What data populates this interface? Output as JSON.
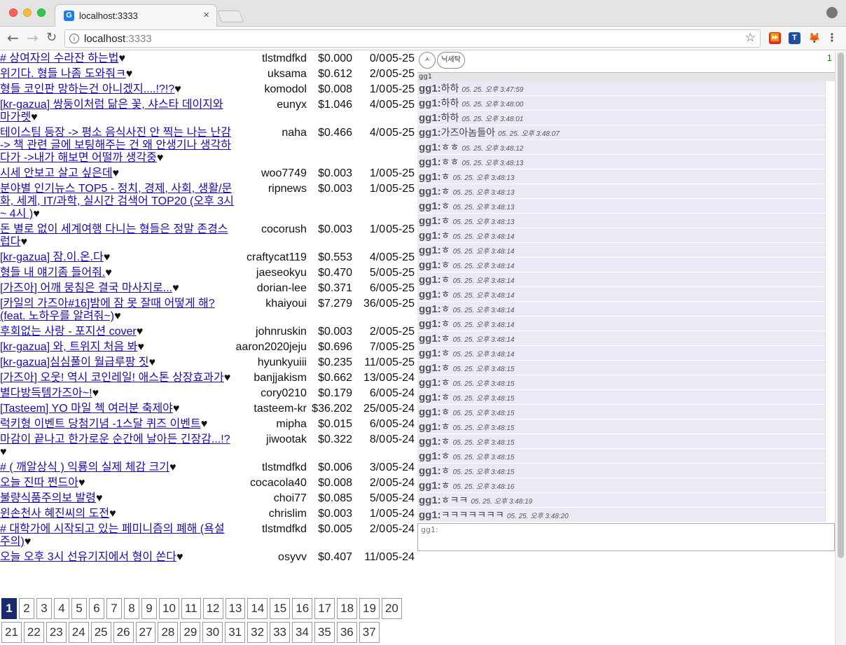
{
  "browser": {
    "tab_title": "localhost:3333",
    "tab_favicon_letter": "G",
    "tab_close": "×",
    "url_host": "localhost",
    "url_port": ":3333",
    "icons": {
      "back": "back-arrow-icon",
      "forward": "forward-arrow-icon",
      "reload": "reload-icon",
      "info": "info-icon",
      "star": "bookmark-star-icon",
      "menu": "kebab-menu-icon",
      "profile": "profile-icon"
    },
    "extensions": [
      "⏩",
      "T",
      "🦊"
    ]
  },
  "posts": [
    {
      "title": "# 상여자의 수라잔 하는법",
      "author": "tlstmdfkd",
      "payout": "$0.000",
      "votes": "0/0",
      "date": "05-25"
    },
    {
      "title": "위기다. 형들 나좀 도와줘ㅋ",
      "author": "uksama",
      "payout": "$0.612",
      "votes": "2/0",
      "date": "05-25"
    },
    {
      "title": "형들 코인판 망하는건 아니겠지....!?!?",
      "author": "komodol",
      "payout": "$0.008",
      "votes": "1/0",
      "date": "05-25"
    },
    {
      "title": "[kr-gazua] 쌍둥이처럼 닮은 꽃, 샤스타 데이지와 마가렛",
      "author": "eunyx",
      "payout": "$1.046",
      "votes": "4/0",
      "date": "05-25"
    },
    {
      "title": "테이스팀 등장 -> 평소 음식사진 안 찍는 나는 난감 -> 책 관련 글에 보팅해주는 건 왜 안생기나 생각하다가 ->내가 해보면 어떨까 생각중",
      "author": "naha",
      "payout": "$0.466",
      "votes": "4/0",
      "date": "05-25"
    },
    {
      "title": "시세 안보고 살고 싶은데",
      "author": "woo7749",
      "payout": "$0.003",
      "votes": "1/0",
      "date": "05-25"
    },
    {
      "title": "분야별 인기뉴스 TOP5 - 정치, 경제, 사회, 생활/문화, 세계, IT/과학, 실시간 검색어 TOP20 (오후 3시 ~ 4시 )",
      "author": "ripnews",
      "payout": "$0.003",
      "votes": "1/0",
      "date": "05-25"
    },
    {
      "title": "돈 별로 없이 세계여행 다니는 형들은 정말 존경스럽다",
      "author": "cocorush",
      "payout": "$0.003",
      "votes": "1/0",
      "date": "05-25"
    },
    {
      "title": "[kr-gazua] 잠.이.온.다",
      "author": "craftycat119",
      "payout": "$0.553",
      "votes": "4/0",
      "date": "05-25"
    },
    {
      "title": "형들 내 얘기좀 들어줘.",
      "author": "jaeseokyu",
      "payout": "$0.470",
      "votes": "5/0",
      "date": "05-25"
    },
    {
      "title": "[가즈아] 어깨 뭉침은 결국 마사지로...",
      "author": "dorian-lee",
      "payout": "$0.371",
      "votes": "6/0",
      "date": "05-25"
    },
    {
      "title": "[카일의 가즈아#16]밤에 잠 못 잘때 어떻게 해? (feat. 노하우를 알려줘~)",
      "author": "khaiyoui",
      "payout": "$7.279",
      "votes": "36/0",
      "date": "05-25"
    },
    {
      "title": "후회없는 사랑 - 포지션 cover",
      "author": "johnruskin",
      "payout": "$0.003",
      "votes": "2/0",
      "date": "05-25"
    },
    {
      "title": "[kr-gazua] 와, 트위지 처음 봐",
      "author": "aaron2020jeju",
      "payout": "$0.696",
      "votes": "7/0",
      "date": "05-25"
    },
    {
      "title": "[kr-gazua]심심풀이 월급루팡 짓",
      "author": "hyunkyuiii",
      "payout": "$0.235",
      "votes": "11/0",
      "date": "05-25"
    },
    {
      "title": "[가즈아] 오웃! 역시 코인레일! 애스톤 상장효과가",
      "author": "banjjakism",
      "payout": "$0.662",
      "votes": "13/0",
      "date": "05-24"
    },
    {
      "title": "별다방득템가즈아~!",
      "author": "cory0210",
      "payout": "$0.179",
      "votes": "6/0",
      "date": "05-24"
    },
    {
      "title": "[Tasteem] YO 마일 첵 여러분 축제야",
      "author": "tasteem-kr",
      "payout": "$36.202",
      "votes": "25/0",
      "date": "05-24"
    },
    {
      "title": "럭키형 이벤트 당첨기념 -1스달 퀴즈 이벤트",
      "author": "mipha",
      "payout": "$0.015",
      "votes": "6/0",
      "date": "05-24"
    },
    {
      "title": "마감이 끝나고 한가로운 순간에 날아든 긴장감...!?",
      "author": "jiwootak",
      "payout": "$0.322",
      "votes": "8/0",
      "date": "05-24"
    },
    {
      "title": "# ( 깨알상식 ) 익룡의 실제 체감 크기",
      "author": "tlstmdfkd",
      "payout": "$0.006",
      "votes": "3/0",
      "date": "05-24"
    },
    {
      "title": "오늘 진따 쩐드아",
      "author": "cocacola40",
      "payout": "$0.008",
      "votes": "2/0",
      "date": "05-24"
    },
    {
      "title": "불량식품주의보 발령",
      "author": "choi77",
      "payout": "$0.085",
      "votes": "5/0",
      "date": "05-24"
    },
    {
      "title": "윈손천사 혜진씨의 도전",
      "author": "chrislim",
      "payout": "$0.003",
      "votes": "1/0",
      "date": "05-24"
    },
    {
      "title": "# 대학가에 시작되고 있는 페미니즘의 폐해 (욕설 주의)",
      "author": "tlstmdfkd",
      "payout": "$0.005",
      "votes": "2/0",
      "date": "05-24"
    },
    {
      "title": "오늘 오후 3시 선유기지에서 형이 쏜다",
      "author": "osyvv",
      "payout": "$0.407",
      "votes": "11/0",
      "date": "05-24"
    }
  ],
  "heart": "♥",
  "pagination": {
    "active": "1",
    "row1": [
      "1",
      "2",
      "3",
      "4",
      "5",
      "6",
      "7",
      "8",
      "9",
      "10",
      "11",
      "12",
      "13",
      "14",
      "15",
      "16",
      "17",
      "18",
      "19",
      "20"
    ],
    "row2": [
      "21",
      "22",
      "23",
      "24",
      "25",
      "26",
      "27",
      "28",
      "29",
      "30",
      "31",
      "32",
      "33",
      "34",
      "35",
      "36",
      "37"
    ]
  },
  "chat": {
    "btn_initial": "ㅅ",
    "btn_nickname": "닉세탁",
    "online_count": "1",
    "header": "gg1",
    "input_label": "gg1:",
    "messages": [
      {
        "user": "gg1:",
        "text": "하하",
        "time": "05. 25. 오후 3:47:59"
      },
      {
        "user": "gg1:",
        "text": "하하",
        "time": "05. 25. 오후 3:48:00"
      },
      {
        "user": "gg1:",
        "text": "하하",
        "time": "05. 25. 오후 3:48:01"
      },
      {
        "user": "gg1:",
        "text": "가즈아놈들아",
        "time": "05. 25. 오후 3:48:07"
      },
      {
        "user": "gg1:",
        "text": "ㅎㅎ",
        "time": "05. 25. 오후 3:48:12"
      },
      {
        "user": "gg1:",
        "text": "ㅎㅎ",
        "time": "05. 25. 오후 3:48:13"
      },
      {
        "user": "gg1:",
        "text": "ㅎ",
        "time": "05. 25. 오후 3:48:13"
      },
      {
        "user": "gg1:",
        "text": "ㅎ",
        "time": "05. 25. 오후 3:48:13"
      },
      {
        "user": "gg1:",
        "text": "ㅎ",
        "time": "05. 25. 오후 3:48:13"
      },
      {
        "user": "gg1:",
        "text": "ㅎ",
        "time": "05. 25. 오후 3:48:13"
      },
      {
        "user": "gg1:",
        "text": "ㅎ",
        "time": "05. 25. 오후 3:48:14"
      },
      {
        "user": "gg1:",
        "text": "ㅎ",
        "time": "05. 25. 오후 3:48:14"
      },
      {
        "user": "gg1:",
        "text": "ㅎ",
        "time": "05. 25. 오후 3:48:14"
      },
      {
        "user": "gg1:",
        "text": "ㅎ",
        "time": "05. 25. 오후 3:48:14"
      },
      {
        "user": "gg1:",
        "text": "ㅎ",
        "time": "05. 25. 오후 3:48:14"
      },
      {
        "user": "gg1:",
        "text": "ㅎ",
        "time": "05. 25. 오후 3:48:14"
      },
      {
        "user": "gg1:",
        "text": "ㅎ",
        "time": "05. 25. 오후 3:48:14"
      },
      {
        "user": "gg1:",
        "text": "ㅎ",
        "time": "05. 25. 오후 3:48:14"
      },
      {
        "user": "gg1:",
        "text": "ㅎ",
        "time": "05. 25. 오후 3:48:14"
      },
      {
        "user": "gg1:",
        "text": "ㅎ",
        "time": "05. 25. 오후 3:48:15"
      },
      {
        "user": "gg1:",
        "text": "ㅎ",
        "time": "05. 25. 오후 3:48:15"
      },
      {
        "user": "gg1:",
        "text": "ㅎ",
        "time": "05. 25. 오후 3:48:15"
      },
      {
        "user": "gg1:",
        "text": "ㅎ",
        "time": "05. 25. 오후 3:48:15"
      },
      {
        "user": "gg1:",
        "text": "ㅎ",
        "time": "05. 25. 오후 3:48:15"
      },
      {
        "user": "gg1:",
        "text": "ㅎ",
        "time": "05. 25. 오후 3:48:15"
      },
      {
        "user": "gg1:",
        "text": "ㅎ",
        "time": "05. 25. 오후 3:48:15"
      },
      {
        "user": "gg1:",
        "text": "ㅎ",
        "time": "05. 25. 오후 3:48:15"
      },
      {
        "user": "gg1:",
        "text": "ㅎ",
        "time": "05. 25. 오후 3:48:16"
      },
      {
        "user": "gg1:",
        "text": "ㅎㅋㅋ",
        "time": "05. 25. 오후 3:48:19"
      },
      {
        "user": "gg1:",
        "text": "ㅋㅋㅋㅋㅋㅋㅋ",
        "time": "05. 25. 오후 3:48:20"
      }
    ]
  }
}
